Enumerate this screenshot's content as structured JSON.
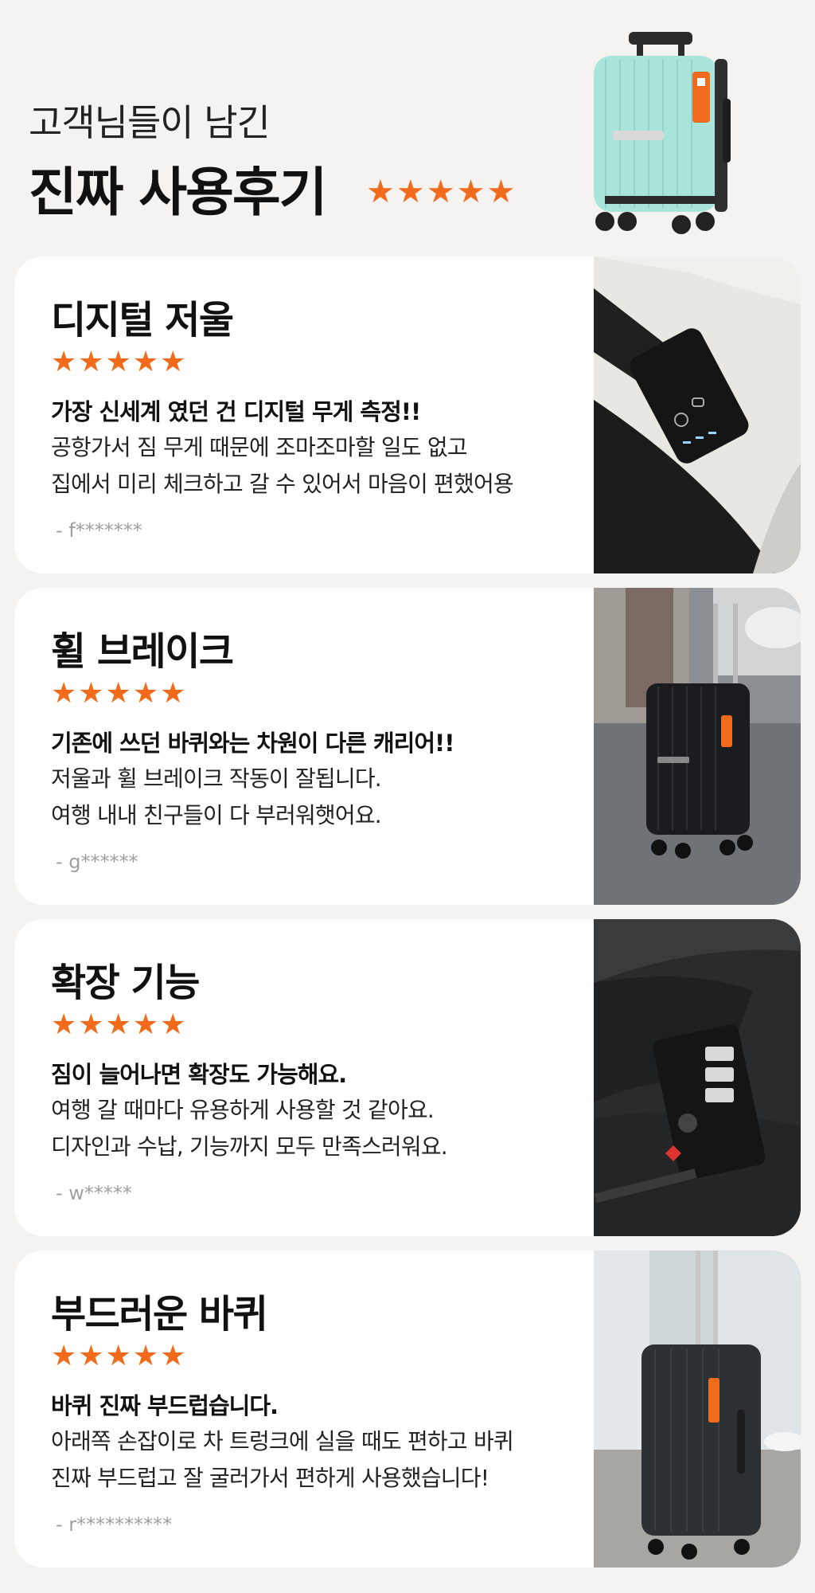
{
  "header": {
    "subtitle": "고객님들이 남긴",
    "title": "진짜 사용후기",
    "stars": "★★★★★"
  },
  "theme": {
    "accent": "#f26a1b",
    "background": "#f4f3f1",
    "card": "#ffffff"
  },
  "reviews": [
    {
      "title": "디지털 저울",
      "stars": "★★★★★",
      "rating": 5,
      "headline": "가장 신세계 였던 건 디지털 무게 측정!!",
      "lines": [
        "공항가서 짐 무게 때문에 조마조마할 일도 없고",
        "집에서 미리 체크하고 갈 수 있어서 마음이 편했어용"
      ],
      "author": "- f*******",
      "photo_icon": "digital-scale-handle-photo"
    },
    {
      "title": "휠 브레이크",
      "stars": "★★★★★",
      "rating": 5,
      "headline": "기존에 쓰던 바퀴와는 차원이 다른 캐리어!!",
      "lines": [
        "저울과 휠 브레이크 작동이 잘됩니다.",
        "여행 내내 친구들이 다 부러워햇어요."
      ],
      "author": "- g******",
      "photo_icon": "black-suitcase-photo"
    },
    {
      "title": "확장 기능",
      "stars": "★★★★★",
      "rating": 5,
      "headline": "짐이 늘어나면 확장도 가능해요.",
      "lines": [
        "여행 갈 때마다 유용하게 사용할 것 같아요.",
        "디자인과 수납, 기능까지 모두 만족스러워요."
      ],
      "author": "- w*****",
      "photo_icon": "tsa-lock-photo"
    },
    {
      "title": "부드러운 바퀴",
      "stars": "★★★★★",
      "rating": 5,
      "headline": "바퀴 진짜 부드럽습니다.",
      "lines": [
        "아래쪽 손잡이로 차 트렁크에 실을 때도 편하고 바퀴",
        "진짜 부드럽고 잘 굴러가서 편하게 사용했습니다!"
      ],
      "author": "- r**********",
      "photo_icon": "gray-suitcase-photo"
    }
  ]
}
